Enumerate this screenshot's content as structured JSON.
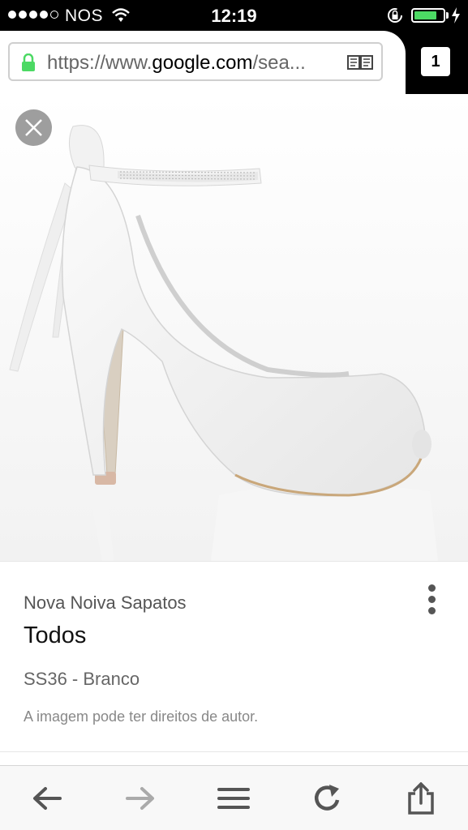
{
  "status_bar": {
    "carrier": "NOS",
    "time": "12:19",
    "battery_level": 0.8,
    "signal_bars_filled": 4,
    "signal_bars_total": 5,
    "icons": [
      "wifi-icon",
      "rotation-lock-icon",
      "battery-icon",
      "charging-icon"
    ]
  },
  "browser": {
    "url_prefix": "https://www.",
    "url_domain": "google.com",
    "url_suffix": "/sea...",
    "tab_count": "1",
    "icons": [
      "lock-icon",
      "reader-mode-icon"
    ]
  },
  "image_viewer": {
    "subject": "white satin peep-toe high heel wedding shoe with rhinestone ankle strap and bow",
    "close_icon": "close-icon"
  },
  "result_card": {
    "source": "Nova Noiva Sapatos",
    "title": "Todos",
    "subtitle": "SS36 - Branco",
    "copyright_notice": "A imagem pode ter direitos de autor."
  },
  "toolbar": {
    "icons": [
      "back-arrow-icon",
      "forward-arrow-icon",
      "menu-icon",
      "reload-icon",
      "share-icon"
    ]
  },
  "colors": {
    "accent_green": "#4cd964",
    "status_bar_bg": "#000000",
    "close_button_bg": "#9e9e9e"
  }
}
